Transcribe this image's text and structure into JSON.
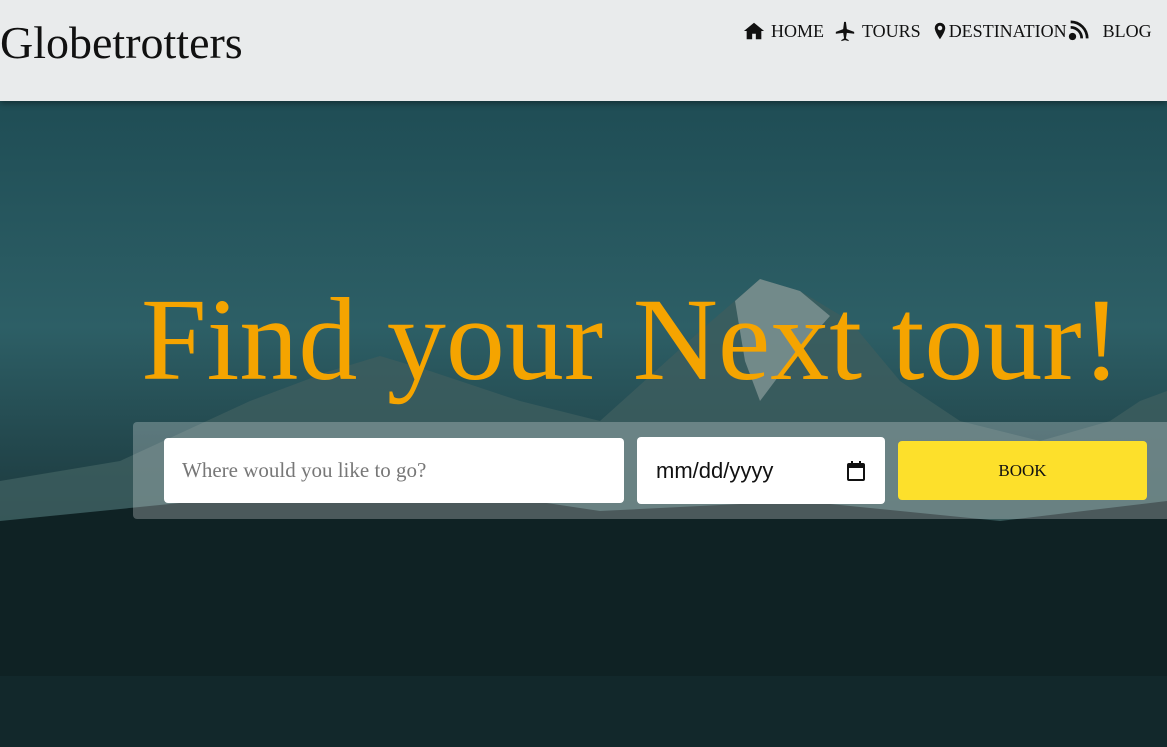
{
  "header": {
    "logo": "Globetrotters",
    "nav": [
      {
        "label": "HOME",
        "icon": "home-icon"
      },
      {
        "label": "TOURS",
        "icon": "plane-icon"
      },
      {
        "label": "DESTINATION",
        "icon": "map-marker-icon"
      },
      {
        "label": "BLOG",
        "icon": "rss-icon"
      }
    ]
  },
  "hero": {
    "title": "Find your Next tour!",
    "search": {
      "placeholder": "Where would you like to go?",
      "date_placeholder": "mm/dd/yyyy",
      "book_label": "BOOK"
    }
  },
  "colors": {
    "accent": "#f5a400",
    "button": "#fde02b"
  }
}
